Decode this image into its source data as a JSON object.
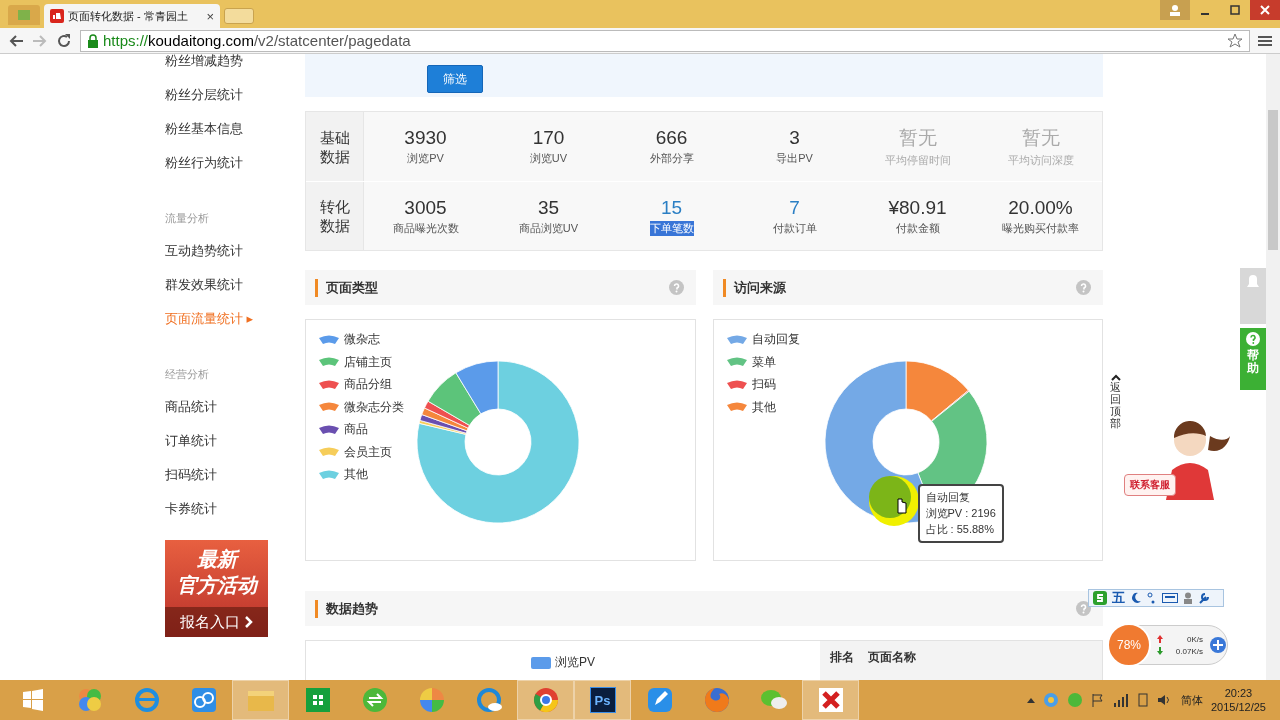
{
  "browser": {
    "tab_title": "页面转化数据 - 常青园土",
    "tab_close": "×",
    "url_scheme": "https://",
    "url_host": "koudaitong.com",
    "url_path": "/v2/statcenter/pagedata"
  },
  "sidebar": {
    "groups": [
      {
        "items": [
          {
            "label": "粉丝增减趋势",
            "selected": false
          },
          {
            "label": "粉丝分层统计",
            "selected": false
          },
          {
            "label": "粉丝基本信息",
            "selected": false
          },
          {
            "label": "粉丝行为统计",
            "selected": false
          }
        ]
      },
      {
        "header": "流量分析",
        "items": [
          {
            "label": "互动趋势统计",
            "selected": false
          },
          {
            "label": "群发效果统计",
            "selected": false
          },
          {
            "label": "页面流量统计",
            "selected": true,
            "marker": "▸"
          }
        ]
      },
      {
        "header": "经营分析",
        "items": [
          {
            "label": "商品统计",
            "selected": false
          },
          {
            "label": "订单统计",
            "selected": false
          },
          {
            "label": "扫码统计",
            "selected": false
          },
          {
            "label": "卡券统计",
            "selected": false
          }
        ]
      }
    ],
    "banner": {
      "line1": "最新",
      "line2": "官方活动",
      "cta": "报名入口"
    }
  },
  "filter": {
    "button": "筛选"
  },
  "stats": [
    {
      "label": "基础数据",
      "cells": [
        {
          "value": "3930",
          "label": "浏览PV",
          "kind": "number",
          "highlighted": false
        },
        {
          "value": "170",
          "label": "浏览UV",
          "kind": "number",
          "highlighted": false
        },
        {
          "value": "666",
          "label": "外部分享",
          "kind": "number",
          "highlighted": false
        },
        {
          "value": "3",
          "label": "导出PV",
          "kind": "number",
          "highlighted": false
        },
        {
          "value": "暂无",
          "label": "平均停留时间",
          "kind": "empty",
          "highlighted": false
        },
        {
          "value": "暂无",
          "label": "平均访问深度",
          "kind": "empty",
          "highlighted": false
        }
      ]
    },
    {
      "label": "转化数据",
      "cells": [
        {
          "value": "3005",
          "label": "商品曝光次数",
          "kind": "number",
          "highlighted": false
        },
        {
          "value": "35",
          "label": "商品浏览UV",
          "kind": "number",
          "highlighted": false
        },
        {
          "value": "15",
          "label": "下单笔数",
          "kind": "link",
          "highlighted": true
        },
        {
          "value": "7",
          "label": "付款订单",
          "kind": "link",
          "highlighted": false
        },
        {
          "value": "¥80.91",
          "label": "付款金额",
          "kind": "number",
          "highlighted": false
        },
        {
          "value": "20.00%",
          "label": "曝光购买付款率",
          "kind": "number",
          "highlighted": false
        }
      ]
    }
  ],
  "page_type": {
    "title": "页面类型",
    "legend": [
      {
        "label": "微杂志",
        "color": "#5b9bea"
      },
      {
        "label": "店铺主页",
        "color": "#5cc47a"
      },
      {
        "label": "商品分组",
        "color": "#ee5050"
      },
      {
        "label": "微杂志分类",
        "color": "#f5873c"
      },
      {
        "label": "商品",
        "color": "#6a4fb0"
      },
      {
        "label": "会员主页",
        "color": "#f6cd5a"
      },
      {
        "label": "其他",
        "color": "#6dd0e0"
      }
    ]
  },
  "source": {
    "title": "访问来源",
    "legend": [
      {
        "label": "自动回复",
        "color": "#74a9e6"
      },
      {
        "label": "菜单",
        "color": "#62c384"
      },
      {
        "label": "扫码",
        "color": "#ee5050"
      },
      {
        "label": "其他",
        "color": "#f5873c"
      }
    ],
    "tooltip": {
      "title": "自动回复",
      "lines": [
        "浏览PV : 2196",
        "占比 : 55.88%"
      ]
    }
  },
  "trend": {
    "title": "数据趋势",
    "legend": [
      {
        "label": "浏览PV",
        "color": "#5b9bea"
      }
    ],
    "table_columns": [
      "排名",
      "页面名称"
    ]
  },
  "widgets": {
    "help": "帮助",
    "back_to_top": "返回顶部",
    "customer_service": "联系客服",
    "ime": "五",
    "network": {
      "percent": "78%",
      "up": "0K/s",
      "down": "0.07K/s"
    }
  },
  "taskbar": {
    "apps": [
      {
        "kind": "colors",
        "active": false
      },
      {
        "kind": "ie",
        "active": false
      },
      {
        "kind": "cloud",
        "active": false
      },
      {
        "kind": "folder",
        "active": true
      },
      {
        "kind": "store",
        "active": false
      },
      {
        "kind": "sync",
        "active": false
      },
      {
        "kind": "pinwheel",
        "active": false
      },
      {
        "kind": "ring",
        "active": false
      },
      {
        "kind": "chrome",
        "active": true
      },
      {
        "kind": "ps",
        "active": true,
        "label": "Ps"
      },
      {
        "kind": "pen",
        "active": false
      },
      {
        "kind": "firefox",
        "active": false
      },
      {
        "kind": "chat",
        "active": false
      },
      {
        "kind": "x",
        "active": true
      }
    ],
    "ime_mode": "简体",
    "time": "20:23",
    "date": "2015/12/25"
  }
}
